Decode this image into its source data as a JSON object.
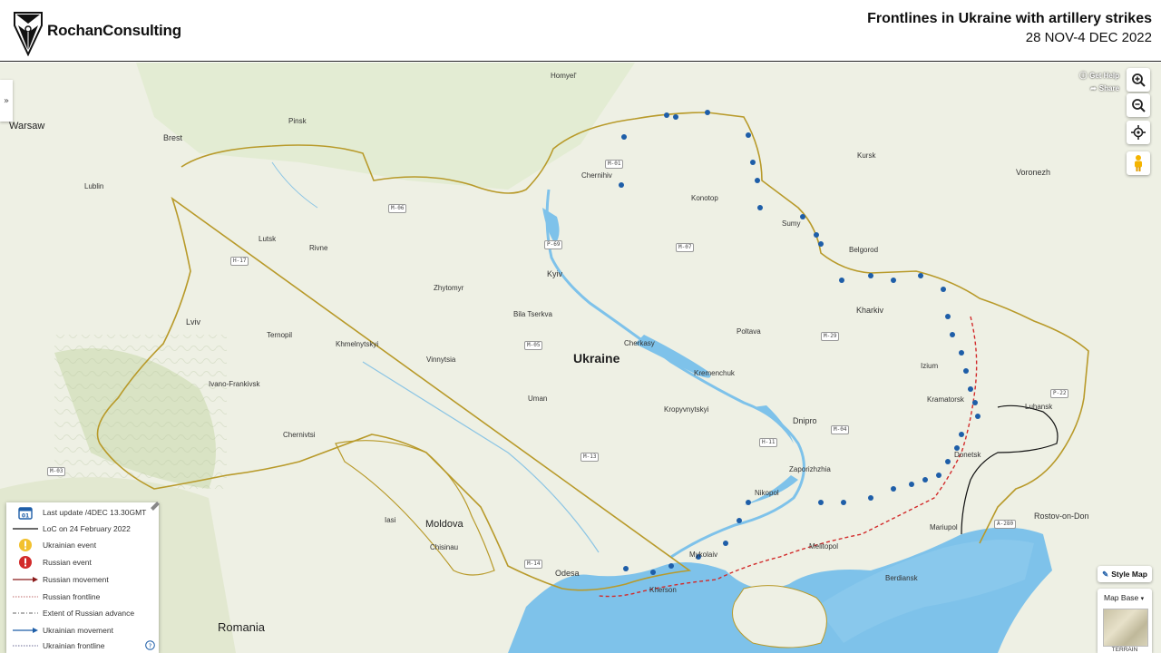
{
  "header": {
    "brand": "RochanConsulting",
    "title": "Frontlines in Ukraine with artillery strikes",
    "subtitle": "28 NOV-4 DEC 2022"
  },
  "colors": {
    "land": "#eef0e4",
    "sea": "#7ec2ea",
    "border_gold": "#b89a2a",
    "ukraine_event": "#1e5ea8",
    "russian_frontline": "#d22b2b"
  },
  "map_controls": {
    "get_help": "Get Help",
    "share": "Share",
    "icons": [
      "zoom-in-icon",
      "zoom-out-icon",
      "locate-icon",
      "street-view-icon"
    ]
  },
  "map_labels": {
    "countries": {
      "ukraine": "Ukraine",
      "moldova": "Moldova",
      "romania": "Romania"
    },
    "cities": [
      {
        "k": "warsaw",
        "t": "Warsaw"
      },
      {
        "k": "brest",
        "t": "Brest"
      },
      {
        "k": "kyiv",
        "t": "Kyiv"
      },
      {
        "k": "kharkiv",
        "t": "Kharkiv"
      },
      {
        "k": "odesa",
        "t": "Odesa"
      },
      {
        "k": "lviv",
        "t": "Lviv"
      },
      {
        "k": "dnipro",
        "t": "Dnipro"
      },
      {
        "k": "voronezh",
        "t": "Voronezh"
      },
      {
        "k": "rostov",
        "t": "Rostov-on-Don"
      },
      {
        "k": "zhytomyr",
        "t": "Zhytomyr"
      },
      {
        "k": "vinnytsia",
        "t": "Vinnytsia"
      },
      {
        "k": "poltava",
        "t": "Poltava"
      },
      {
        "k": "chernihiv",
        "t": "Chernihiv"
      },
      {
        "k": "sumy",
        "t": "Sumy"
      },
      {
        "k": "kherson",
        "t": "Kherson"
      },
      {
        "k": "mykolaiv",
        "t": "Mykolaiv"
      },
      {
        "k": "zaporizhzhia",
        "t": "Zaporizhzhia"
      },
      {
        "k": "mariupol",
        "t": "Mariupol"
      },
      {
        "k": "melitopol",
        "t": "Melitopol"
      },
      {
        "k": "luhansk",
        "t": "Luhansk"
      },
      {
        "k": "donetsk",
        "t": "Donetsk"
      },
      {
        "k": "kursk",
        "t": "Kursk"
      },
      {
        "k": "belgorod",
        "t": "Belgorod"
      },
      {
        "k": "chisinau",
        "t": "Chisinau"
      },
      {
        "k": "iasi",
        "t": "Iasi"
      },
      {
        "k": "rivne",
        "t": "Rivne"
      },
      {
        "k": "lutsk",
        "t": "Lutsk"
      },
      {
        "k": "ternopil",
        "t": "Ternopil"
      },
      {
        "k": "kropyvnytskyi",
        "t": "Kropyvnytskyi"
      },
      {
        "k": "kramatorsk",
        "t": "Kramatorsk"
      },
      {
        "k": "izium",
        "t": "Izium"
      },
      {
        "k": "cherkasy",
        "t": "Cherkasy"
      },
      {
        "k": "uman",
        "t": "Uman"
      },
      {
        "k": "khmelnytskyi",
        "t": "Khmelnytskyi"
      },
      {
        "k": "chernivtsi",
        "t": "Chernivtsi"
      },
      {
        "k": "ivano",
        "t": "Ivano-Frankivsk"
      },
      {
        "k": "nikopol",
        "t": "Nikopol"
      },
      {
        "k": "berdiansk",
        "t": "Berdiansk"
      },
      {
        "k": "kremenchuk",
        "t": "Kremenchuk"
      },
      {
        "k": "bilatserkva",
        "t": "Bila Tserkva"
      },
      {
        "k": "konotop",
        "t": "Konotop"
      },
      {
        "k": "lublin",
        "t": "Lublin"
      },
      {
        "k": "pinsk",
        "t": "Pinsk"
      },
      {
        "k": "gomel",
        "t": "Homyel'"
      }
    ]
  },
  "roads": [
    "P-69",
    "M-07",
    "M-05",
    "M-13",
    "M-29",
    "M-04",
    "H-11",
    "M-14",
    "P-22",
    "A-280",
    "M-03",
    "M-06",
    "H-17",
    "M-01"
  ],
  "legend": {
    "items": [
      {
        "k": "last_update",
        "t": "Last update /4DEC 13.30GMT"
      },
      {
        "k": "loc",
        "t": "LoC on 24 February 2022"
      },
      {
        "k": "ua_event",
        "t": "Ukrainian event"
      },
      {
        "k": "ru_event",
        "t": "Russian event"
      },
      {
        "k": "ru_move",
        "t": "Russian movement"
      },
      {
        "k": "ru_front",
        "t": "Russian frontline"
      },
      {
        "k": "ru_extent",
        "t": "Extent of Russian advance"
      },
      {
        "k": "ua_move",
        "t": "Ukrainian movement"
      },
      {
        "k": "ua_front",
        "t": "Ukrainian frontline"
      }
    ],
    "calendar_day": "01"
  },
  "map_style": {
    "style_map": "Style Map",
    "map_base": "Map Base",
    "terrain": "TERRAIN"
  }
}
